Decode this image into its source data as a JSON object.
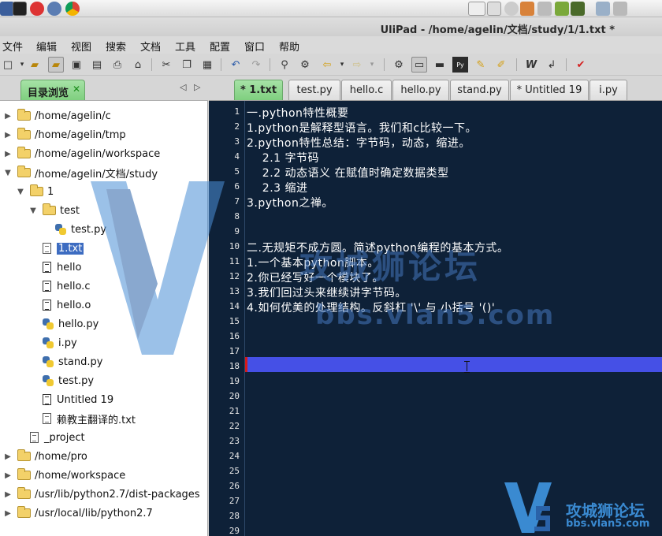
{
  "window": {
    "title": "UliPad - /home/agelin/文档/study/1/1.txt *"
  },
  "menu": [
    "文件",
    "编辑",
    "视图",
    "搜索",
    "文档",
    "工具",
    "配置",
    "窗口",
    "帮助"
  ],
  "left_panel": {
    "tab_label": "目录浏览",
    "tree": [
      {
        "label": "/home/agelin/c",
        "type": "folder",
        "expanded": false
      },
      {
        "label": "/home/agelin/tmp",
        "type": "folder",
        "expanded": false
      },
      {
        "label": "/home/agelin/workspace",
        "type": "folder",
        "expanded": false
      },
      {
        "label": "/home/agelin/文档/study",
        "type": "folder",
        "expanded": true
      },
      {
        "label": "1",
        "type": "folder",
        "expanded": true
      },
      {
        "label": "test",
        "type": "folder",
        "expanded": true
      },
      {
        "label": "test.py",
        "type": "python"
      },
      {
        "label": "1.txt",
        "type": "text",
        "selected": true
      },
      {
        "label": "hello",
        "type": "file"
      },
      {
        "label": "hello.c",
        "type": "file"
      },
      {
        "label": "hello.o",
        "type": "file"
      },
      {
        "label": "hello.py",
        "type": "python"
      },
      {
        "label": "i.py",
        "type": "python"
      },
      {
        "label": "stand.py",
        "type": "python"
      },
      {
        "label": "test.py",
        "type": "python"
      },
      {
        "label": "Untitled 19",
        "type": "file"
      },
      {
        "label": "赖教主翻译的.txt",
        "type": "text"
      },
      {
        "label": "_project",
        "type": "text"
      },
      {
        "label": "/home/pro",
        "type": "folder",
        "expanded": false
      },
      {
        "label": "/home/workspace",
        "type": "folder",
        "expanded": false
      },
      {
        "label": "/usr/lib/python2.7/dist-packages",
        "type": "folder",
        "expanded": false
      },
      {
        "label": "/usr/local/lib/python2.7",
        "type": "folder",
        "expanded": false
      }
    ]
  },
  "editor_tabs": [
    {
      "label": "* 1.txt",
      "active": true
    },
    {
      "label": "test.py",
      "active": false
    },
    {
      "label": "hello.c",
      "active": false
    },
    {
      "label": "hello.py",
      "active": false
    },
    {
      "label": "stand.py",
      "active": false
    },
    {
      "label": "* Untitled 19",
      "active": false
    },
    {
      "label": "i.py",
      "active": false
    }
  ],
  "editor": {
    "current_line": 18,
    "lines": [
      "一.python特性概要",
      "1.python是解释型语言。我们和c比较一下。",
      "2.python特性总结：字节码，动态，缩进。",
      "    2.1 字节码",
      "    2.2 动态语义 在赋值时确定数据类型",
      "    2.3 缩进",
      "3.python之禅。",
      "",
      "",
      "二.无规矩不成方圆。简述python编程的基本方式。",
      "1.一个基本python脚本。",
      "2.你已经写好一个模块了。",
      "3.我们回过头来继续讲字节码。",
      "4.如何优美的处理结构。反斜杠 '\\' 与 小括号 '()'",
      "",
      "",
      "",
      "",
      "",
      "",
      "",
      "",
      "",
      "",
      "",
      "",
      "",
      "",
      ""
    ]
  },
  "watermark": {
    "text": "攻城狮论坛",
    "url": "bbs.vlan5.com"
  },
  "colors": {
    "editor_bg": "#0e2138",
    "current_line": "#4550e6",
    "active_tab": "#8fd88f",
    "selection": "#3d6cc1"
  }
}
